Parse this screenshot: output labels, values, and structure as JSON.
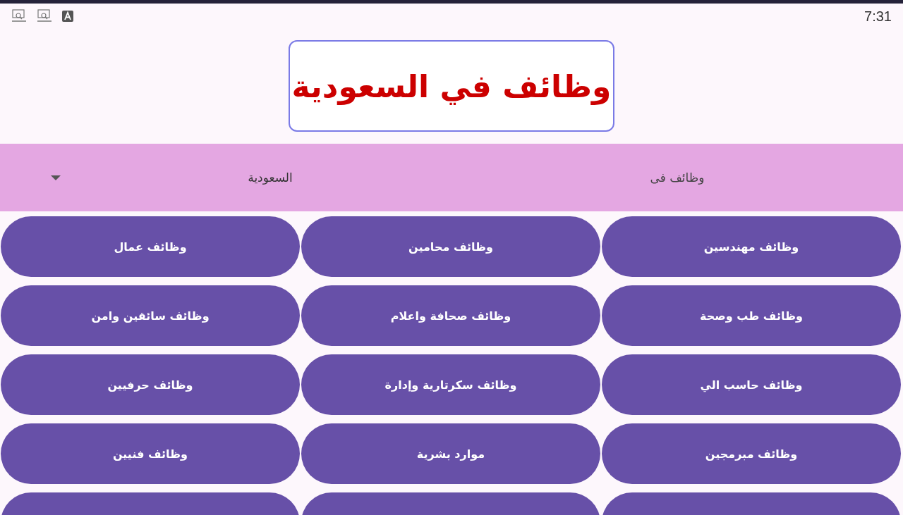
{
  "status_bar": {
    "time": "7:31"
  },
  "logo": {
    "title": "وظائف في السعودية"
  },
  "filter_bar": {
    "label": "وظائف فى",
    "dropdown_value": "السعودية"
  },
  "job_buttons": [
    {
      "label": "وظائف مهندسين"
    },
    {
      "label": "وظائف محامين"
    },
    {
      "label": "وظائف عمال"
    },
    {
      "label": "وظائف طب وصحة"
    },
    {
      "label": "وظائف صحافة واعلام"
    },
    {
      "label": "وظائف سائقين وامن"
    },
    {
      "label": "وظائف حاسب الي"
    },
    {
      "label": "وظائف سكرتارية وإدارة"
    },
    {
      "label": "وظائف حرفيين"
    },
    {
      "label": "وظائف مبرمجين"
    },
    {
      "label": "موارد بشرية"
    },
    {
      "label": "وظائف فنيين"
    }
  ]
}
